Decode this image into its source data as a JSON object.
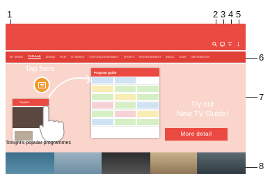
{
  "callouts": [
    "1",
    "2",
    "3",
    "4",
    "5",
    "6",
    "7",
    "8"
  ],
  "tabs": [
    "MY SENSE",
    "POPULAR",
    "DRAMA",
    "FILM",
    "TV SERIES",
    "FOR CHILDREN/FAMILY",
    "SPORTS",
    "ENTERTAINMENT",
    "MUSIC",
    "SOAP",
    "INFORMATION"
  ],
  "top_icons": [
    "search-icon",
    "cast-icon",
    "filter-icon",
    "more-icon"
  ],
  "banner": {
    "tap_here": "Tap here",
    "mock_title": "Program guide",
    "try_line1": "Try our",
    "try_line2": "New TV Guide!",
    "more_detail": "More detail",
    "mini_phone_title": "Top pitch"
  },
  "popular_heading": "Tonight's popular programmes",
  "colors": {
    "accent": "#ea4a41",
    "banner": "#f9d5cc",
    "tap_circle": "#f29a2e"
  }
}
